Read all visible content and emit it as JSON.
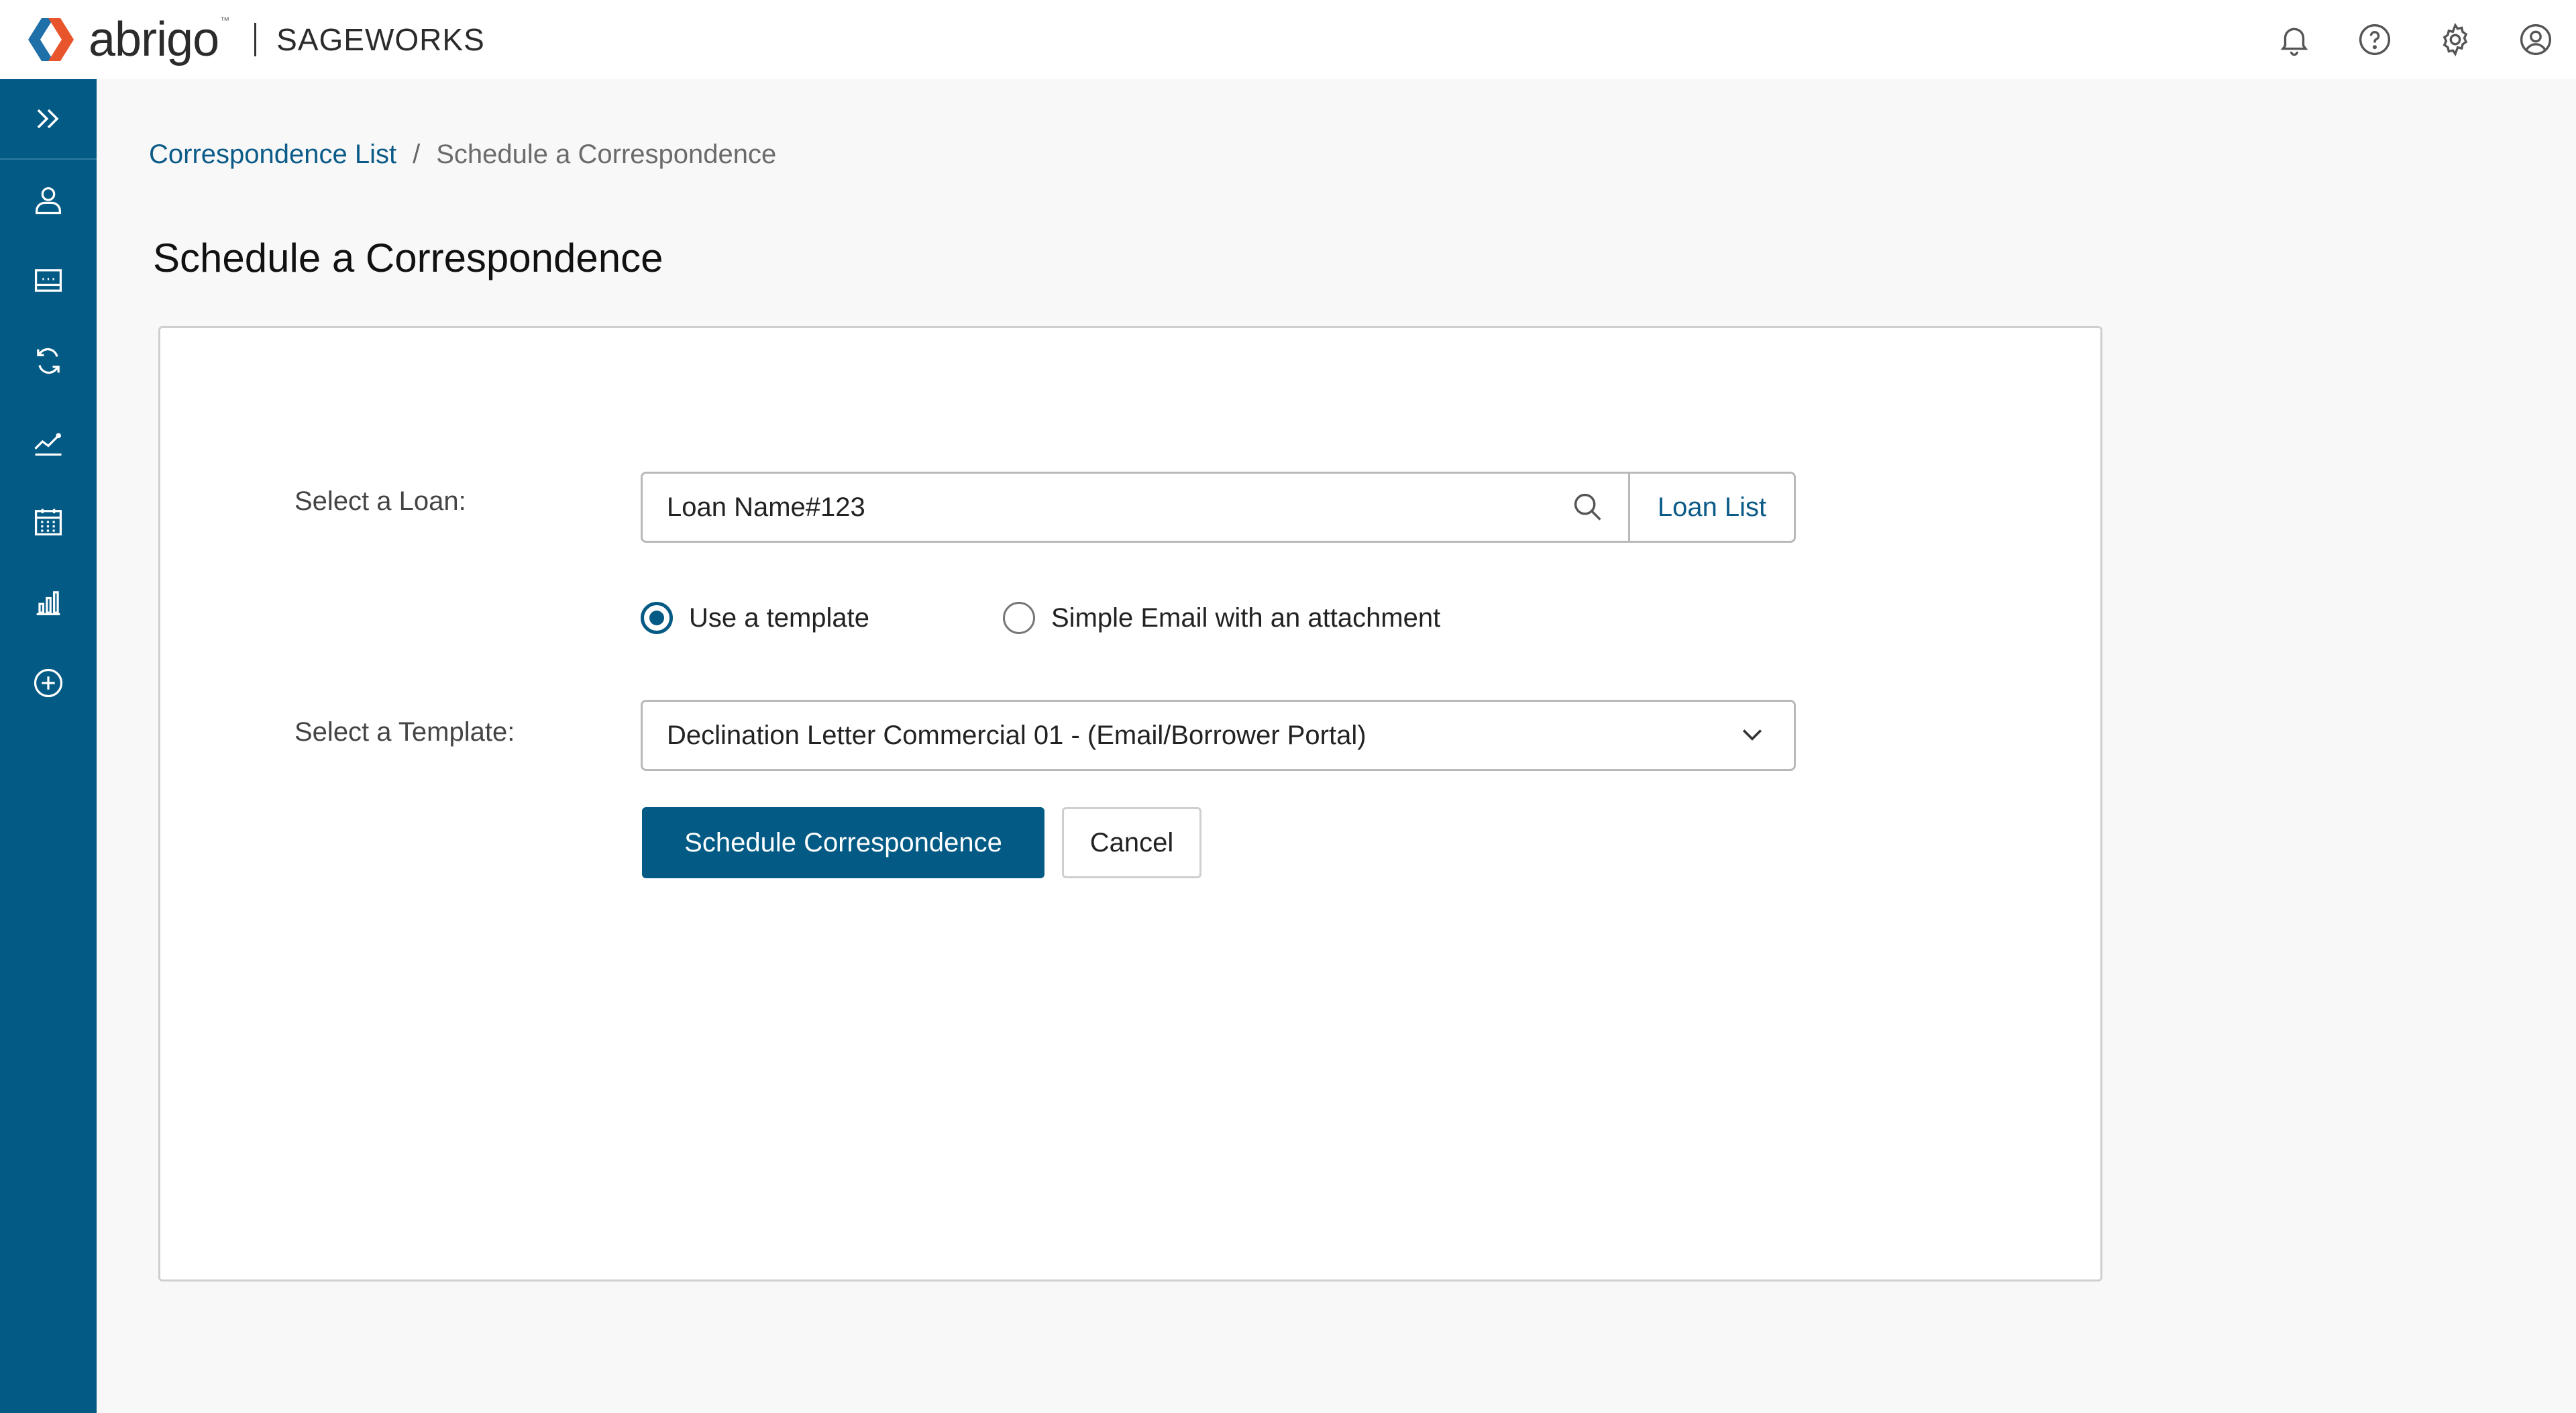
{
  "header": {
    "brand": "abrigo",
    "brand_tm": "™",
    "product": "SAGEWORKS",
    "icons": [
      "bell-icon",
      "help-icon",
      "gear-icon",
      "user-circle-icon"
    ]
  },
  "sidebar": {
    "items": [
      {
        "icon": "expand-chevrons-icon"
      },
      {
        "icon": "person-icon"
      },
      {
        "icon": "inbox-icon"
      },
      {
        "icon": "refresh-icon"
      },
      {
        "icon": "trend-line-icon"
      },
      {
        "icon": "calendar-icon"
      },
      {
        "icon": "bar-chart-icon"
      },
      {
        "icon": "plus-circle-icon"
      }
    ]
  },
  "breadcrumb": {
    "parent": "Correspondence List",
    "separator": "/",
    "current": "Schedule a Correspondence"
  },
  "page": {
    "title": "Schedule a Correspondence"
  },
  "form": {
    "loan_label": "Select a Loan:",
    "loan_value": "Loan Name#123",
    "loan_list_button": "Loan List",
    "radio_options": [
      {
        "label": "Use a template",
        "checked": true
      },
      {
        "label": "Simple Email with an attachment",
        "checked": false
      }
    ],
    "template_label": "Select a Template:",
    "template_value": "Declination Letter Commercial 01 - (Email/Borrower Portal)",
    "submit_button": "Schedule Correspondence",
    "cancel_button": "Cancel"
  },
  "colors": {
    "brand_blue": "#035a85",
    "link_blue": "#0b5a88",
    "logo_orange": "#e8542b",
    "logo_blue": "#1f6fa8"
  }
}
